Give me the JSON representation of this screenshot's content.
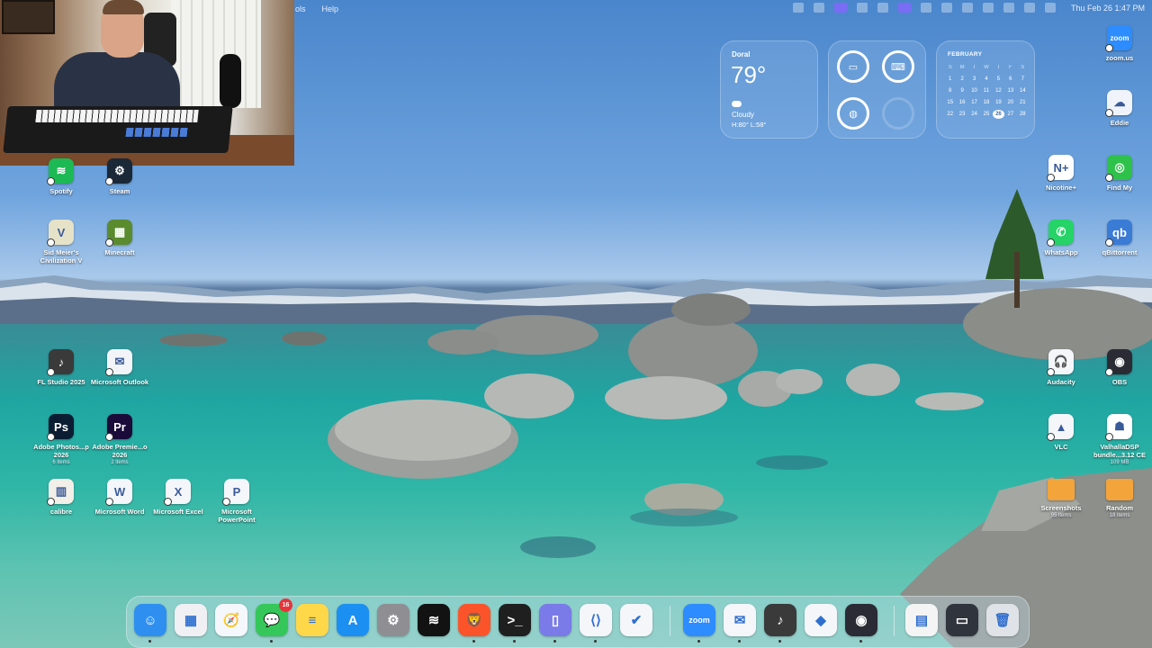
{
  "menubar": {
    "menus": [
      "ols",
      "Help"
    ],
    "clock": "Thu Feb 26  1:47 PM"
  },
  "widgets": {
    "weather": {
      "city": "Doral",
      "temp": "79°",
      "condition": "Cloudy",
      "high_low": "H:80° L:58°"
    },
    "calendar": {
      "month": "FEBRUARY",
      "day_headers": [
        "S",
        "M",
        "T",
        "W",
        "T",
        "F",
        "S"
      ],
      "days": [
        "1",
        "2",
        "3",
        "4",
        "5",
        "6",
        "7",
        "8",
        "9",
        "10",
        "11",
        "12",
        "13",
        "14",
        "15",
        "16",
        "17",
        "18",
        "19",
        "20",
        "21",
        "22",
        "23",
        "24",
        "25",
        "26",
        "27",
        "28"
      ],
      "today": "26"
    }
  },
  "desktop_left": [
    {
      "label": "Spotify",
      "sub": "",
      "color": "#1db954",
      "icon": "spotify-icon",
      "glyph": "≋"
    },
    {
      "label": "Steam",
      "sub": "",
      "color": "#1b2838",
      "icon": "steam-icon",
      "glyph": "⚙"
    },
    {
      "label": "Sid Meier's Civilization V",
      "sub": "",
      "color": "#e6e2c8",
      "icon": "civilization-icon",
      "glyph": "V"
    },
    {
      "label": "Minecraft",
      "sub": "",
      "color": "#5b8b2f",
      "icon": "minecraft-icon",
      "glyph": "▦"
    },
    {
      "label": "FL Studio 2025",
      "sub": "",
      "color": "#3a3a3a",
      "icon": "fl-studio-icon",
      "glyph": "♪"
    },
    {
      "label": "Microsoft Outlook",
      "sub": "",
      "color": "#f2f4f8",
      "icon": "outlook-icon",
      "glyph": "✉"
    },
    {
      "label": "Adobe Photos...p 2026",
      "sub": "6 items",
      "color": "#0b1d33",
      "icon": "photoshop-icon",
      "glyph": "Ps"
    },
    {
      "label": "Adobe Premie...o 2026",
      "sub": "2 items",
      "color": "#1a0b3a",
      "icon": "premiere-icon",
      "glyph": "Pr"
    },
    {
      "label": "calibre",
      "sub": "",
      "color": "#f2efe8",
      "icon": "calibre-icon",
      "glyph": "▥"
    },
    {
      "label": "Microsoft Word",
      "sub": "",
      "color": "#f4f6fa",
      "icon": "word-icon",
      "glyph": "W"
    },
    {
      "label": "Microsoft Excel",
      "sub": "",
      "color": "#f4f6fa",
      "icon": "excel-icon",
      "glyph": "X"
    },
    {
      "label": "Microsoft PowerPoint",
      "sub": "",
      "color": "#f4f6fa",
      "icon": "powerpoint-icon",
      "glyph": "P"
    }
  ],
  "desktop_right": [
    {
      "label": "zoom.us",
      "sub": "",
      "color": "#2d8cff",
      "icon": "zoom-icon",
      "glyph": "zoom"
    },
    {
      "label": "Eddie",
      "sub": "",
      "color": "#f0f4fa",
      "icon": "icloud-icon",
      "glyph": "☁"
    },
    {
      "label": "Nicotine+",
      "sub": "",
      "color": "#ffffff",
      "icon": "nicotine-icon",
      "glyph": "N+"
    },
    {
      "label": "Find My",
      "sub": "",
      "color": "#2ec24a",
      "icon": "find-my-icon",
      "glyph": "◎"
    },
    {
      "label": "WhatsApp",
      "sub": "",
      "color": "#25d366",
      "icon": "whatsapp-icon",
      "glyph": "✆"
    },
    {
      "label": "qBittorrent",
      "sub": "",
      "color": "#3a7bd5",
      "icon": "qbittorrent-icon",
      "glyph": "qb"
    },
    {
      "label": "Audacity",
      "sub": "",
      "color": "#f4f6fa",
      "icon": "audacity-icon",
      "glyph": "🎧"
    },
    {
      "label": "OBS",
      "sub": "",
      "color": "#2b2b35",
      "icon": "obs-icon",
      "glyph": "◉"
    },
    {
      "label": "VLC",
      "sub": "",
      "color": "#f4f6fa",
      "icon": "vlc-icon",
      "glyph": "▲"
    },
    {
      "label": "ValhallaDSP bundle...3.12 CE",
      "sub": "109 MB",
      "color": "#ffffff",
      "icon": "valhalla-icon",
      "glyph": "☗"
    },
    {
      "label": "Screenshots",
      "sub": "95 items",
      "color": "#f3a43a",
      "icon": "folder-icon",
      "glyph": ""
    },
    {
      "label": "Random",
      "sub": "18 items",
      "color": "#f3a43a",
      "icon": "folder-icon",
      "glyph": ""
    }
  ],
  "dock": {
    "apps": [
      {
        "name": "finder",
        "color": "#2f8ff0",
        "glyph": "☺"
      },
      {
        "name": "launchpad",
        "color": "#f0f0f4",
        "glyph": "▦"
      },
      {
        "name": "safari",
        "color": "#f4f7fb",
        "glyph": "🧭"
      },
      {
        "name": "messages",
        "color": "#35c759",
        "glyph": "💬",
        "badge": "16"
      },
      {
        "name": "notes",
        "color": "#ffd84a",
        "glyph": "≡"
      },
      {
        "name": "app-store",
        "color": "#1b8ff2",
        "glyph": "A"
      },
      {
        "name": "system-settings",
        "color": "#8e8e93",
        "glyph": "⚙"
      },
      {
        "name": "spotify",
        "color": "#121212",
        "glyph": "≋"
      },
      {
        "name": "brave",
        "color": "#fb542b",
        "glyph": "🦁"
      },
      {
        "name": "terminal",
        "color": "#1f1f1f",
        "glyph": ">_"
      },
      {
        "name": "simulator",
        "color": "#7a7ae8",
        "glyph": "▯"
      },
      {
        "name": "vscode",
        "color": "#f4f6fa",
        "glyph": "⟨⟩"
      },
      {
        "name": "things",
        "color": "#f4f6fa",
        "glyph": "✔"
      },
      {
        "name": "zoom",
        "color": "#2d8cff",
        "glyph": "zoom"
      },
      {
        "name": "outlook",
        "color": "#f4f6fa",
        "glyph": "✉"
      },
      {
        "name": "fl-studio",
        "color": "#3a3a3a",
        "glyph": "♪"
      },
      {
        "name": "shortcuts",
        "color": "#f4f6fa",
        "glyph": "◆"
      },
      {
        "name": "obs",
        "color": "#2b2b35",
        "glyph": "◉"
      },
      {
        "name": "recent-document",
        "color": "#f4f4f4",
        "glyph": "▤"
      },
      {
        "name": "recent-window",
        "color": "#30343c",
        "glyph": "▭"
      },
      {
        "name": "trash",
        "color": "#dfe3e8",
        "glyph": "🗑"
      }
    ]
  }
}
